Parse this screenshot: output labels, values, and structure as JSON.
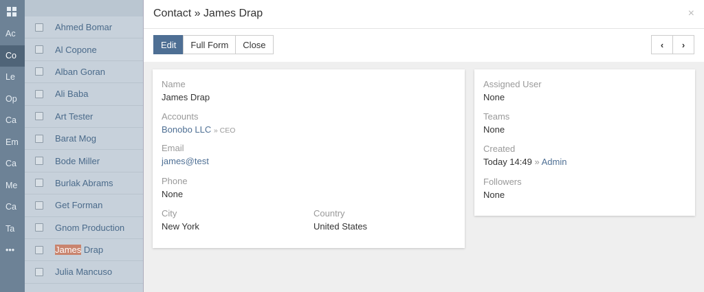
{
  "nav": {
    "items": [
      {
        "label": "Ac",
        "active": false
      },
      {
        "label": "Co",
        "active": true
      },
      {
        "label": "Le",
        "active": false
      },
      {
        "label": "Op",
        "active": false
      },
      {
        "label": "Ca",
        "active": false
      },
      {
        "label": "Em",
        "active": false
      },
      {
        "label": "Ca",
        "active": false
      },
      {
        "label": "Me",
        "active": false
      },
      {
        "label": "Ca",
        "active": false
      },
      {
        "label": "Ta",
        "active": false
      },
      {
        "label": "•••",
        "active": false
      }
    ]
  },
  "list": {
    "items": [
      "Ahmed Bomar",
      "Al Copone",
      "Alban Goran",
      "Ali Baba",
      "Art Tester",
      "Barat Mog",
      "Bode Miller",
      "Burlak Abrams",
      "Get Forman",
      "Gnom Production",
      "James Drap",
      "Julia Mancuso"
    ],
    "highlight": {
      "prefix": "James",
      "suffix": " Drap"
    }
  },
  "modal": {
    "title": "Contact » James Drap",
    "close": "×",
    "buttons": {
      "edit": "Edit",
      "full_form": "Full Form",
      "close": "Close",
      "prev": "‹",
      "next": "›"
    }
  },
  "main": {
    "name_label": "Name",
    "name_value": "James Drap",
    "accounts_label": "Accounts",
    "account_name": "Bonobo LLC",
    "account_role": "» CEO",
    "email_label": "Email",
    "email_value": "james@test",
    "phone_label": "Phone",
    "phone_value": "None",
    "city_label": "City",
    "city_value": "New York",
    "country_label": "Country",
    "country_value": "United States"
  },
  "side": {
    "assigned_label": "Assigned User",
    "assigned_value": "None",
    "teams_label": "Teams",
    "teams_value": "None",
    "created_label": "Created",
    "created_value": "Today 14:49",
    "created_sep": "»",
    "created_by": "Admin",
    "followers_label": "Followers",
    "followers_value": "None"
  }
}
